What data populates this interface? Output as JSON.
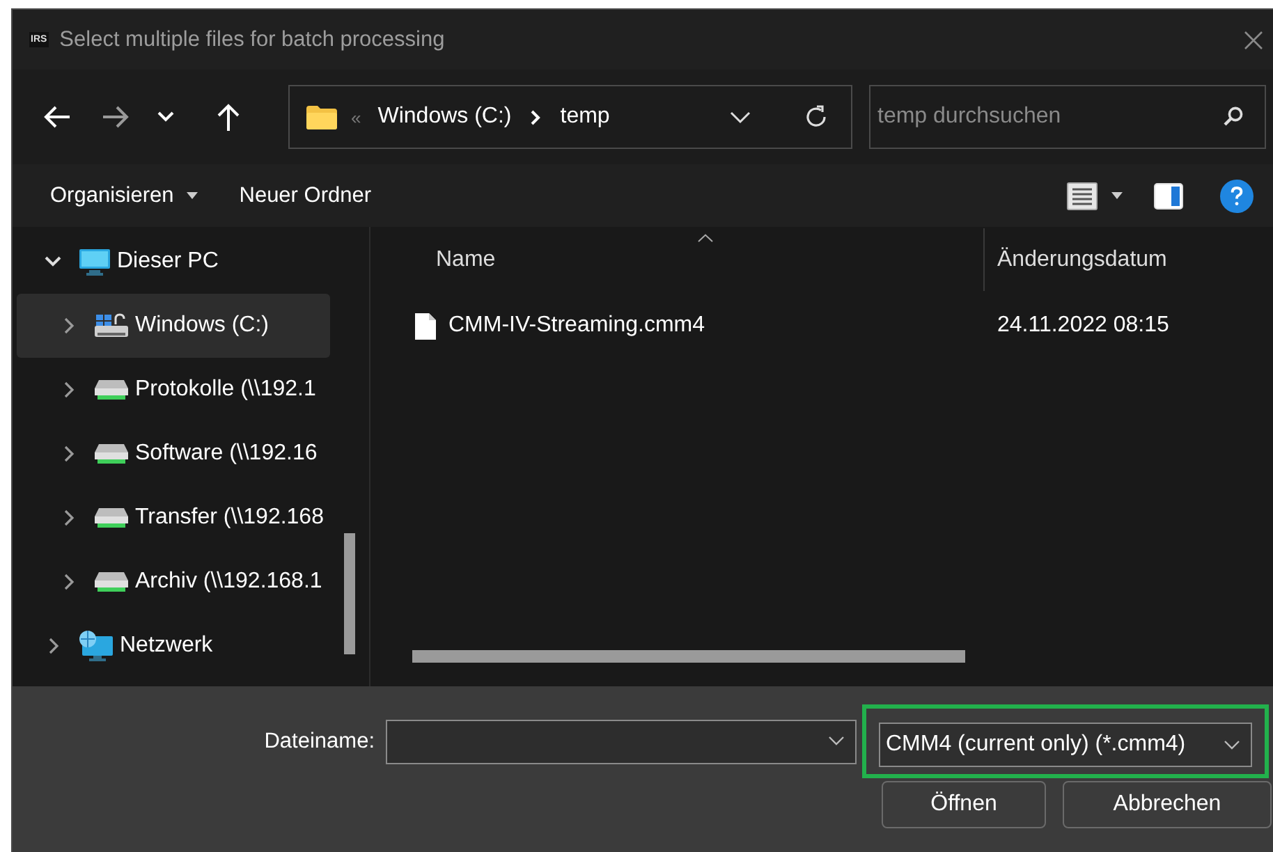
{
  "window": {
    "title": "Select multiple files for batch processing",
    "app_icon_text": "IRS"
  },
  "nav_buttons": [
    {
      "kind": "back",
      "disabled": false
    },
    {
      "kind": "forward",
      "disabled": true
    },
    {
      "kind": "recent",
      "disabled": false
    },
    {
      "kind": "up",
      "disabled": false
    }
  ],
  "address": {
    "overflow": "«",
    "path": [
      "Windows (C:)",
      "temp"
    ]
  },
  "search": {
    "placeholder": "temp durchsuchen"
  },
  "toolbar": {
    "organize": "Organisieren",
    "new_folder": "Neuer Ordner"
  },
  "sidebar": {
    "items": [
      {
        "label": "Dieser PC",
        "kind": "pc",
        "expanded": true,
        "selected": false,
        "children": [
          {
            "label": "Windows (C:)",
            "kind": "drive",
            "expanded": false,
            "selected": true
          },
          {
            "label": "Protokolle (\\\\192.1",
            "kind": "netdrive",
            "expanded": false,
            "selected": false
          },
          {
            "label": "Software (\\\\192.16",
            "kind": "netdrive",
            "expanded": false,
            "selected": false
          },
          {
            "label": "Transfer (\\\\192.168",
            "kind": "netdrive",
            "expanded": false,
            "selected": false
          },
          {
            "label": "Archiv (\\\\192.168.1",
            "kind": "netdrive",
            "expanded": false,
            "selected": false
          }
        ]
      },
      {
        "label": "Netzwerk",
        "kind": "network",
        "expanded": false,
        "selected": false
      }
    ]
  },
  "table": {
    "columns": [
      {
        "label": "Name",
        "sorted": true
      },
      {
        "label": "Änderungsdatum",
        "sorted": false
      }
    ],
    "rows": [
      {
        "name": "CMM-IV-Streaming.cmm4",
        "modified": "24.11.2022 08:15"
      }
    ]
  },
  "footer": {
    "filename_label": "Dateiname:",
    "filetype": {
      "value": "CMM4 (current only) (*.cmm4)",
      "highlighted": true
    },
    "buttons": [
      "Öffnen",
      "Abbrechen"
    ]
  }
}
